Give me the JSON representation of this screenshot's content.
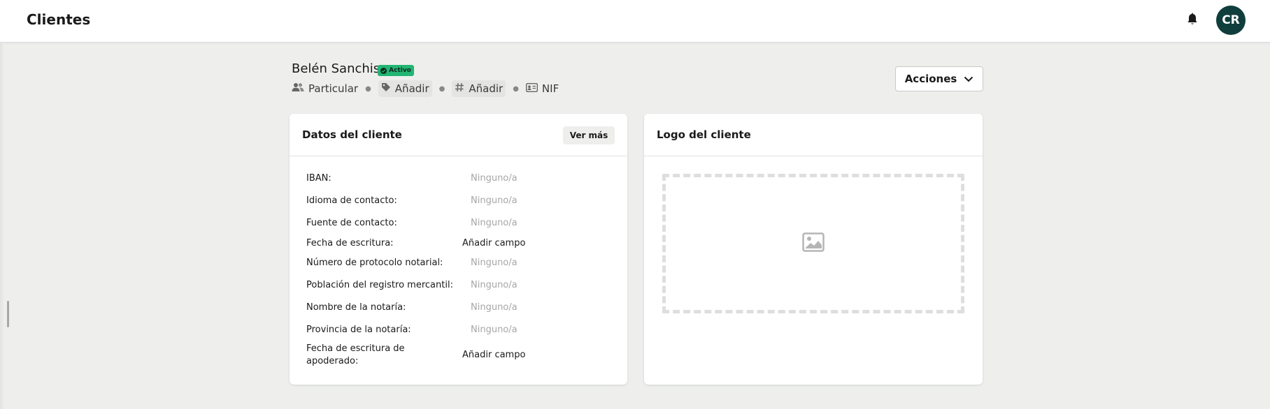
{
  "topbar": {
    "title": "Clientes",
    "avatar_initials": "CR",
    "bell_icon": "bell-icon"
  },
  "client": {
    "name": "Belén Sanchis",
    "status_badge": "Activo",
    "type_label": "Particular",
    "tag_add_label": "Añadir",
    "code_add_label": "Añadir",
    "id_label": "NIF"
  },
  "actions": {
    "label": "Acciones"
  },
  "client_data_card": {
    "title": "Datos del cliente",
    "more_button": "Ver más",
    "fields": [
      {
        "label": "IBAN:",
        "value": "Ninguno/a"
      },
      {
        "label": "Idioma de contacto:",
        "value": "Ninguno/a"
      },
      {
        "label": "Fuente de contacto:",
        "value": "Ninguno/a"
      },
      {
        "label": "Fecha de escritura:",
        "value": "Añadir campo"
      },
      {
        "label": "Número de protocolo notarial:",
        "value": "Ninguno/a"
      },
      {
        "label": "Población del registro mercantil:",
        "value": "Ninguno/a"
      },
      {
        "label": "Nombre de la notaría:",
        "value": "Ninguno/a"
      },
      {
        "label": "Provincia de la notaría:",
        "value": "Ninguno/a"
      },
      {
        "label": "Fecha de escritura de apoderado:",
        "value": "Añadir campo"
      }
    ]
  },
  "logo_card": {
    "title": "Logo del cliente",
    "placeholder_icon": "image-placeholder-icon"
  },
  "colors": {
    "accent": "#0f3e3c",
    "status_active": "#22b573",
    "background": "#eeefed"
  }
}
